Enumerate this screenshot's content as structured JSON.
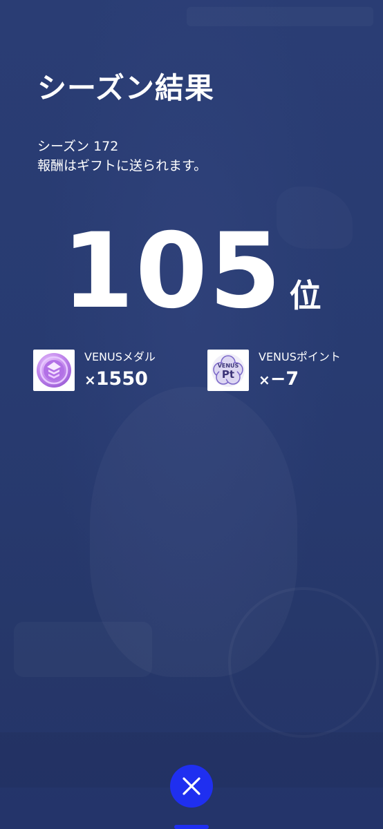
{
  "header": {
    "title": "シーズン結果"
  },
  "season": {
    "line1": "シーズン 172",
    "line2": "報酬はギフトに送られます。"
  },
  "rank": {
    "number": "105",
    "unit": "位"
  },
  "rewards": [
    {
      "label": "VENUSメダル",
      "times": "×",
      "amount": "1550",
      "icon": "venus-medal-icon"
    },
    {
      "label": "VENUSポイント",
      "times": "×",
      "amount": "−7",
      "icon": "venus-point-icon",
      "icon_text_top": "VENUS",
      "icon_text_main": "Pt"
    }
  ],
  "colors": {
    "background": "#283a70",
    "close_button": "#1f2ff0",
    "text": "#ffffff"
  },
  "close_icon": "close-icon"
}
